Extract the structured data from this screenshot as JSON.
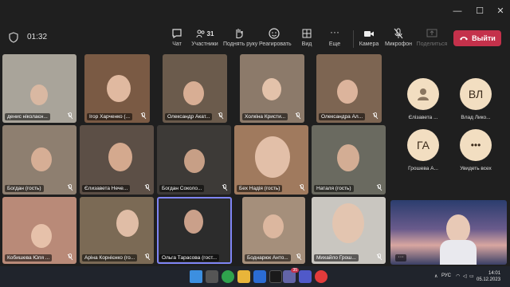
{
  "window": {
    "minimize": "—",
    "maximize": "☐",
    "close": "✕"
  },
  "meeting": {
    "timer": "01:32"
  },
  "toolbar": {
    "chat": "Чат",
    "participants": "Участники",
    "participants_count": "31",
    "raise_hand": "Поднять руку",
    "react": "Реагировать",
    "view": "Вид",
    "more": "Еще",
    "camera": "Камера",
    "mic": "Микрофон",
    "share": "Поделиться",
    "leave": "Выйти"
  },
  "tiles": [
    {
      "name": "денис ніколаєн..."
    },
    {
      "name": "Ігор Харченко (..."
    },
    {
      "name": "Олександр Акат..."
    },
    {
      "name": "Холкіна Кристи..."
    },
    {
      "name": "Олександра Ал..."
    },
    {
      "name": "Богдан (гость)"
    },
    {
      "name": "Єлизавета Нече..."
    },
    {
      "name": "Богдан Соколо..."
    },
    {
      "name": "Бех Надія (гость)"
    },
    {
      "name": "Наталя (гость)"
    },
    {
      "name": "Кобишева Юля ..."
    },
    {
      "name": "Аріна Корнієнко (го..."
    },
    {
      "name": "Ольга Тарасова (гост..."
    },
    {
      "name": "Боднарюк Анто..."
    },
    {
      "name": "Михайло Грош..."
    },
    {
      "name": ""
    }
  ],
  "side_participants": [
    {
      "name": "Єлізавета ...",
      "initials": ""
    },
    {
      "name": "Влад Лико...",
      "initials": "ВЛ"
    },
    {
      "name": "Грошева А...",
      "initials": "ГА"
    },
    {
      "name": "Увидеть всех",
      "initials": "•••"
    }
  ],
  "taskbar": {
    "chat_badge": "35",
    "lang": "РУС",
    "time": "14:01",
    "date": "05.12.2023"
  },
  "colors": {
    "accent": "#7f85f5",
    "leave": "#c4314b",
    "avatar_bg": "#f2dec1"
  }
}
